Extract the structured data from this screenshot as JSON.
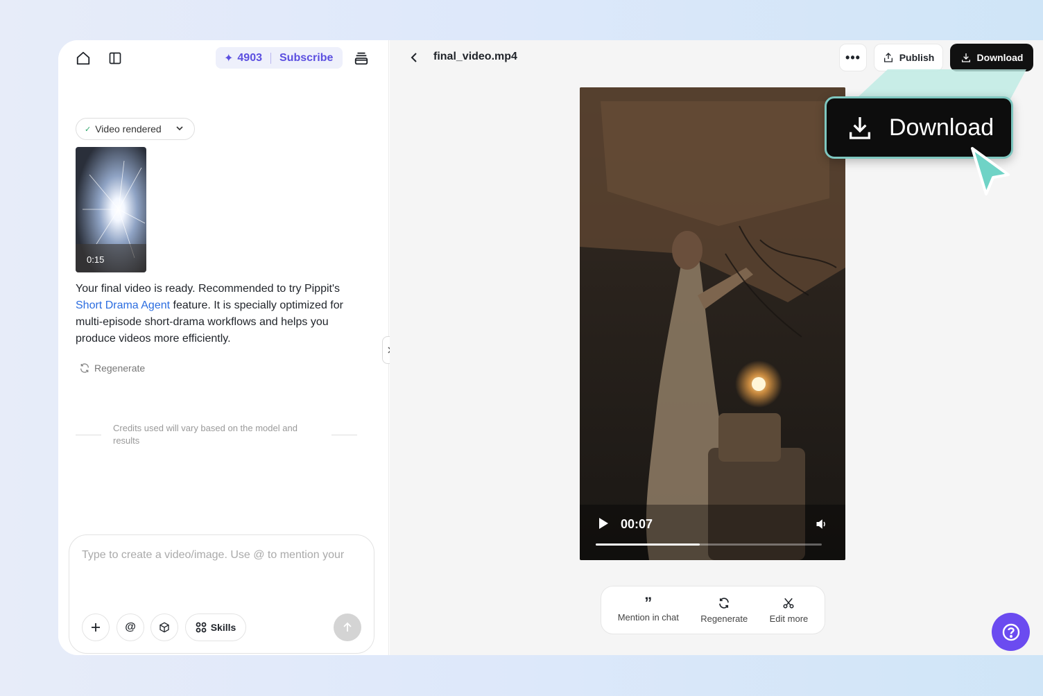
{
  "header": {
    "credits": "4903",
    "subscribe_label": "Subscribe"
  },
  "chat": {
    "status_chip": "Video rendered",
    "thumbnail_duration": "0:15",
    "message_before_link": "Your final video is ready. Recommended to try Pippit's ",
    "message_link": "Short Drama Agent",
    "message_after_link": " feature. It is specially optimized for multi-episode short-drama workflows and helps you produce videos more efficiently.",
    "regenerate_label": "Regenerate",
    "credits_note": "Credits used will vary based on the model and results"
  },
  "composer": {
    "placeholder": "Type to create a video/image. Use @ to mention your",
    "skills_label": "Skills"
  },
  "viewer": {
    "file_name": "final_video.mp4",
    "publish_label": "Publish",
    "download_label": "Download",
    "current_time": "00:07",
    "progress": 0.46,
    "actions": [
      {
        "label": "Mention in chat",
        "icon": "quote-icon"
      },
      {
        "label": "Regenerate",
        "icon": "refresh-icon"
      },
      {
        "label": "Edit more",
        "icon": "scissors-icon"
      }
    ]
  },
  "callout": {
    "label": "Download"
  },
  "colors": {
    "accent": "#5b4fe0",
    "link": "#2b6de0",
    "help": "#6b4bf0",
    "callout_border": "#7ec7c0"
  }
}
